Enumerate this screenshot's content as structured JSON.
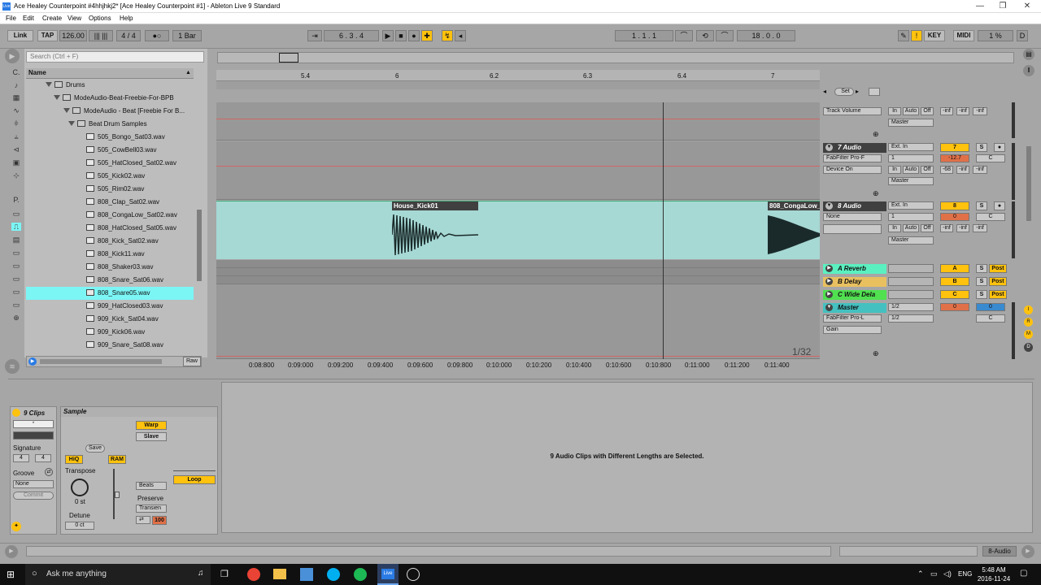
{
  "window": {
    "title": "Ace Healey Counterpoint #4hhjhkj2*  [Ace Healey Counterpoint #1] - Ableton Live 9 Standard",
    "app_icon": "Live"
  },
  "menu": [
    "File",
    "Edit",
    "Create",
    "View",
    "Options",
    "Help"
  ],
  "transport": {
    "link": "Link",
    "tap": "TAP",
    "tempo": "126.00",
    "meter": "4 / 4",
    "metro": "●○",
    "quant": "1 Bar",
    "position": "6 .  3 .  4",
    "loop_start": "1 .  1 .  1",
    "loop_len": "18 .  0 .  0",
    "key": "KEY",
    "midi": "MIDI",
    "cpu": "1 %",
    "disk": "D"
  },
  "browser": {
    "search_placeholder": "Search (Ctrl + F)",
    "header": "Name",
    "folders": [
      "Drums",
      "ModeAudio-Beat-Freebie-For-BPB",
      "ModeAudio - Beat [Freebie For B...",
      "Beat Drum Samples"
    ],
    "files": [
      "505_Bongo_Sat03.wav",
      "505_CowBell03.wav",
      "505_HatClosed_Sat02.wav",
      "505_Kick02.wav",
      "505_Rim02.wav",
      "808_Clap_Sat02.wav",
      "808_CongaLow_Sat02.wav",
      "808_HatClosed_Sat05.wav",
      "808_Kick_Sat02.wav",
      "808_Kick11.wav",
      "808_Shaker03.wav",
      "808_Snare_Sat06.wav",
      "808_Snare05.wav",
      "909_HatClosed03.wav",
      "909_Kick_Sat04.wav",
      "909_Kick06.wav",
      "909_Snare_Sat08.wav"
    ],
    "selected": "808_Snare05.wav",
    "raw": "Raw",
    "sidebar_labels": [
      "C.",
      "P."
    ]
  },
  "arrangement": {
    "ruler": [
      "5.4",
      "6",
      "6.2",
      "6.3",
      "6.4",
      "7"
    ],
    "time_ruler": [
      "0:08:800",
      "0:09:000",
      "0:09:200",
      "0:09:400",
      "0:09:600",
      "0:09:800",
      "0:10:000",
      "0:10:200",
      "0:10:400",
      "0:10:600",
      "0:10:800",
      "0:11:000",
      "0:11:200",
      "0:11:400"
    ],
    "clips": [
      "House_Kick01",
      "808_CongaLow_"
    ],
    "grid": "1/32",
    "set": "Set"
  },
  "mixer": {
    "track_volume": "Track Volume",
    "master": "Master",
    "tracks": [
      {
        "name": "7 Audio",
        "input": "Ext. In",
        "device": "FabFilter Pro-F",
        "dev2": "Device On",
        "ch": "1",
        "vol": "-12.7",
        "num": "7",
        "pan": "C",
        "sends": [
          "-68",
          "-inf",
          "-inf"
        ]
      },
      {
        "name": "8 Audio",
        "input": "Ext. In",
        "device": "None",
        "ch": "1",
        "vol": "0",
        "num": "8",
        "pan": "C",
        "sends": [
          "-inf",
          "-inf",
          "-inf"
        ]
      }
    ],
    "returns": [
      {
        "name": "A Reverb",
        "letter": "A",
        "color": "#5bf0c0"
      },
      {
        "name": "B Delay",
        "letter": "B",
        "color": "#e8c060"
      },
      {
        "name": "C Wide Dela",
        "letter": "C",
        "color": "#50e050"
      }
    ],
    "master_track": {
      "name": "Master",
      "out": "1/2",
      "device": "FabFilter Pro-L",
      "gain": "Gain",
      "vol": "0",
      "cue": "0",
      "pan": "C"
    },
    "io": [
      "In",
      "Auto",
      "Off"
    ],
    "inf": "-inf",
    "solo": "S",
    "post": "Post"
  },
  "clipview": {
    "title": "9 Clips",
    "sample_title": "Sample",
    "signature_label": "Signature",
    "sig_num": "4",
    "sig_den": "4",
    "groove_label": "Groove",
    "groove": "None",
    "commit": "Commit",
    "save": "Save",
    "hiq": "HiQ",
    "ram": "RAM",
    "warp": "Warp",
    "slave": "Slave",
    "loop": "Loop",
    "transpose": "Transpose",
    "transpose_val": "0 st",
    "detune": "Detune",
    "detune_val": "0 ct",
    "beats": "Beats",
    "preserve": "Preserve",
    "transients": "Transien",
    "percent": "100",
    "message": "9 Audio Clips with Different Lengths are Selected."
  },
  "status": {
    "track": "8-Audio"
  },
  "taskbar": {
    "search": "Ask me anything",
    "lang": "ENG",
    "time": "5:48 AM",
    "date": "2016-11-24"
  }
}
